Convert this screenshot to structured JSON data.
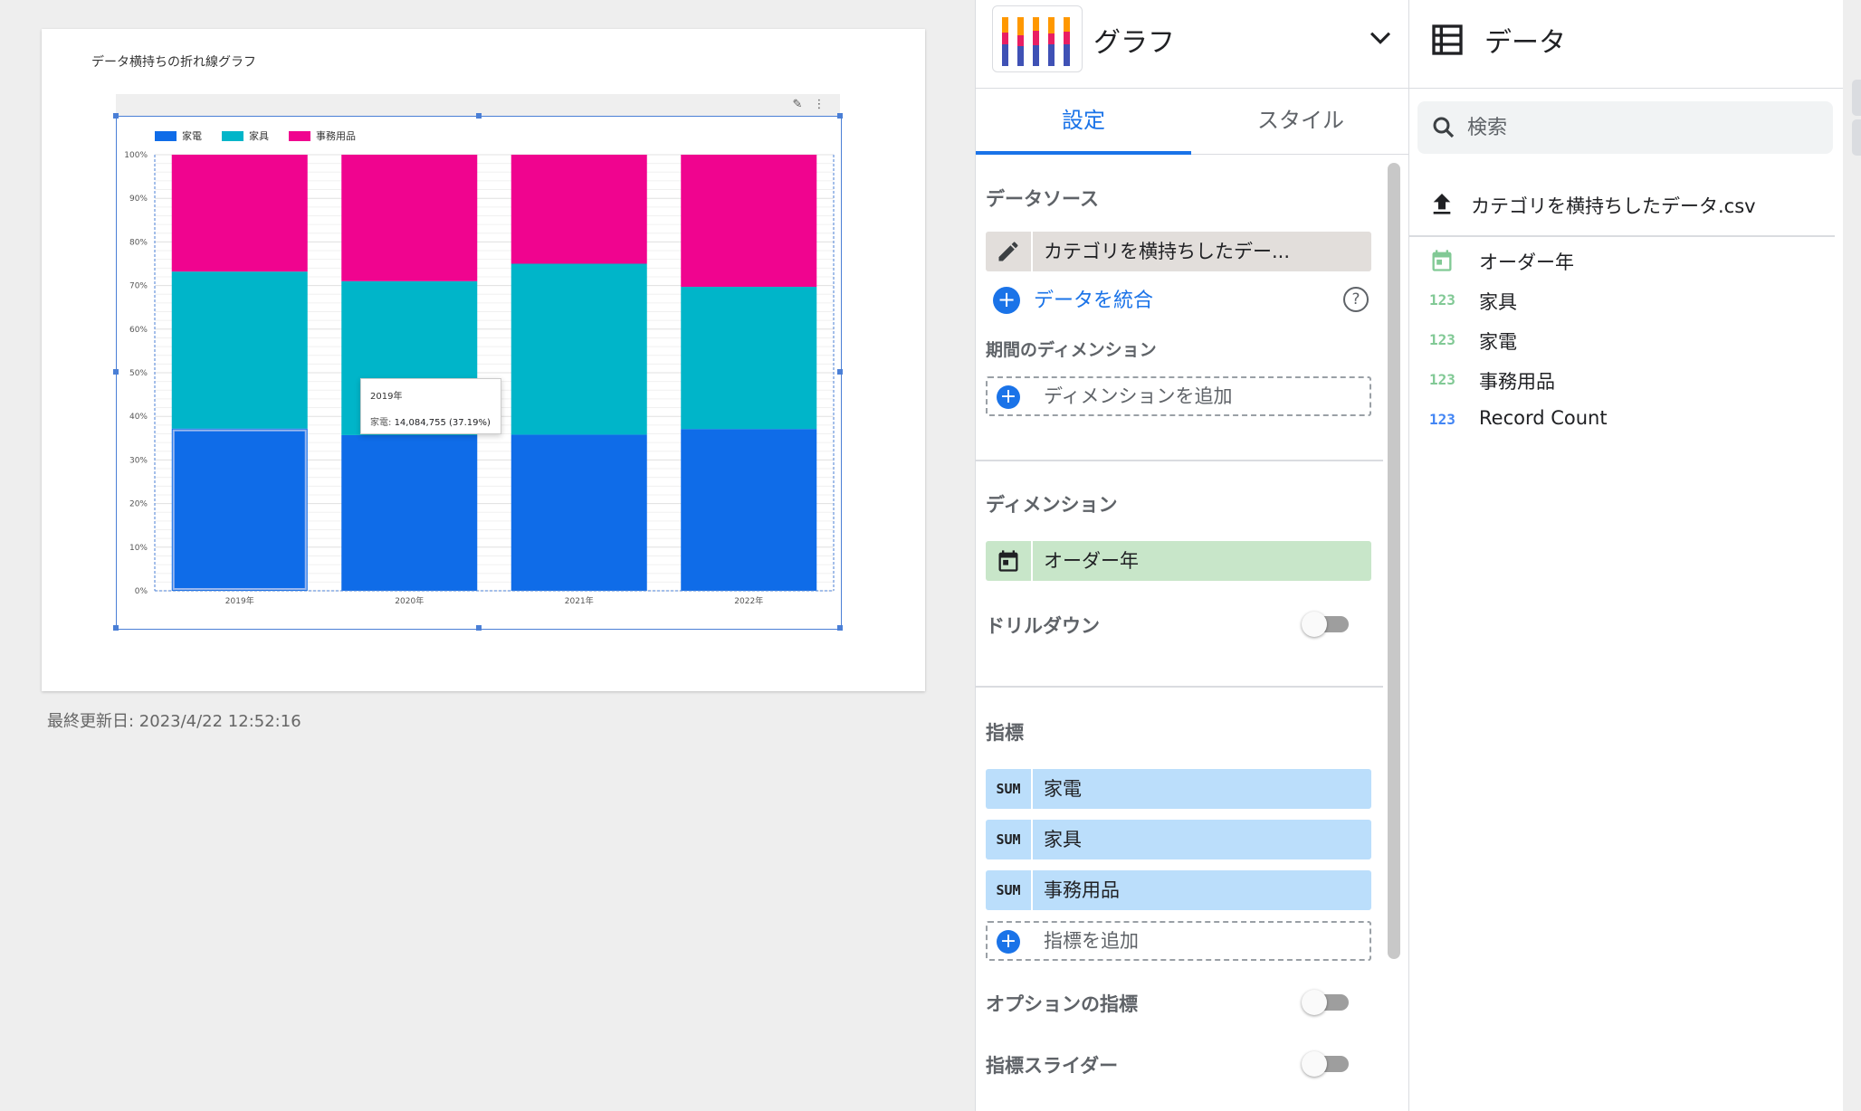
{
  "report": {
    "title": "データ横持ちの折れ線グラフ",
    "last_updated": "最終更新日: 2023/4/22 12:52:16"
  },
  "chart_data": {
    "type": "bar",
    "stacked": "percent",
    "categories": [
      "2019年",
      "2020年",
      "2021年",
      "2022年"
    ],
    "series": [
      {
        "name": "家電",
        "values": [
          37.2,
          35.7,
          35.8,
          37.1
        ],
        "color": "#0f6ce8"
      },
      {
        "name": "家具",
        "values": [
          36.0,
          35.3,
          39.2,
          32.6
        ],
        "color": "#00b5c9"
      },
      {
        "name": "事務用品",
        "values": [
          26.8,
          29.0,
          25.0,
          30.3
        ],
        "color": "#f0048f"
      }
    ],
    "ylim": [
      0,
      100
    ],
    "yticks": [
      "0%",
      "10%",
      "20%",
      "30%",
      "40%",
      "50%",
      "60%",
      "70%",
      "80%",
      "90%",
      "100%"
    ],
    "grid": true,
    "legend": "top-left",
    "tooltip": {
      "title": "2019年",
      "series": "家電",
      "value": "14,084,755 (37.19%)"
    }
  },
  "props": {
    "chart_type_label": "グラフ",
    "tabs": [
      {
        "label": "設定",
        "active": true
      },
      {
        "label": "スタイル",
        "active": false
      }
    ],
    "data_source": {
      "title": "データソース",
      "value": "カテゴリを横持ちしたデー...",
      "blend_label": "データを統合"
    },
    "date_dimension": {
      "title": "期間のディメンション",
      "add_label": "ディメンションを追加"
    },
    "dimension": {
      "title": "ディメンション",
      "value": "オーダー年",
      "drilldown_label": "ドリルダウン"
    },
    "metrics": {
      "title": "指標",
      "items": [
        {
          "agg": "SUM",
          "label": "家電"
        },
        {
          "agg": "SUM",
          "label": "家具"
        },
        {
          "agg": "SUM",
          "label": "事務用品"
        }
      ],
      "add_label": "指標を追加",
      "optional_label": "オプションの指標",
      "slider_label": "指標スライダー"
    }
  },
  "data_panel": {
    "title": "データ",
    "search_placeholder": "検索",
    "source_name": "カテゴリを横持ちしたデータ.csv",
    "fields": [
      {
        "type_icon": "calendar-icon",
        "label": "オーダー年"
      },
      {
        "type_icon": "123",
        "label": "家具"
      },
      {
        "type_icon": "123",
        "label": "家電"
      },
      {
        "type_icon": "123",
        "label": "事務用品"
      },
      {
        "type_icon": "123",
        "label": "Record Count"
      }
    ]
  }
}
